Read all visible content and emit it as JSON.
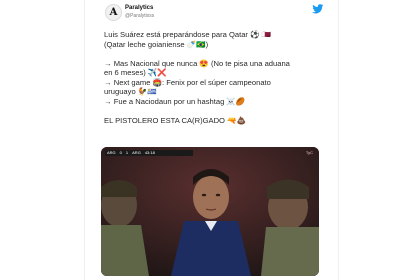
{
  "tweet": {
    "display_name": "Paralytics",
    "handle": "@Paralytixss",
    "avatar_letter": "A",
    "lines": [
      "Luis Suárez está preparándose para Qatar ⚽ 🇶🇦",
      "(Qatar leche goianiense 🍼🇧🇷)",
      "",
      "→ Mas Nacional que nunca 😍 (No te pisa una aduana",
      "en 6 meses) ✈️❌",
      "→ Next game 🏟️: Fenix por el súper campeonato",
      "uruguayo 🐓🇺🇾",
      "→ Fue a Naciodaun por un hashtag ☠️🏉",
      "",
      "EL PISTOLERO ESTA CA(R)GADO 🔫💩"
    ]
  },
  "media": {
    "scorebug": {
      "team1": "ARG",
      "score1": "0",
      "score2": "1",
      "team2": "ARG",
      "clock": "43:18"
    },
    "overlay_logo": "TyC"
  },
  "colors": {
    "background": "#ffffff",
    "text": "#2a2a2a",
    "twitter_blue": "#1d9bf0"
  },
  "icons": {
    "logo": "twitter-bird-icon"
  }
}
